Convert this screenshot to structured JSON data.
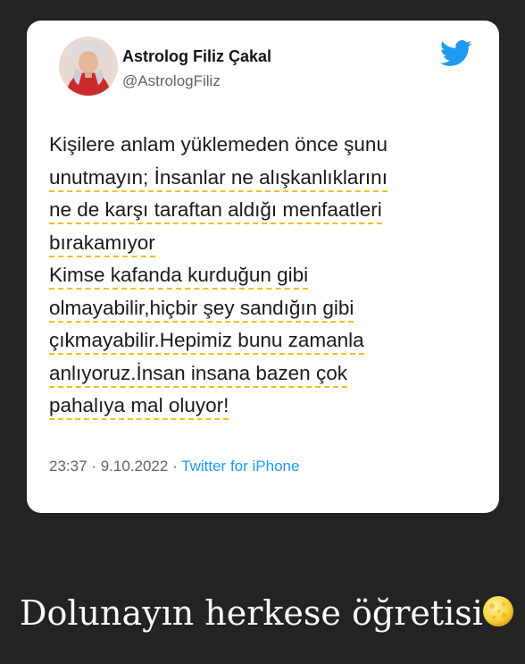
{
  "tweet": {
    "author_name": "Astrolog Filiz Çakal",
    "author_handle": "@AstrologFiliz",
    "lines": [
      "Kişilere anlam yüklemeden önce şunu",
      "unutmayın; İnsanlar ne alışkanlıklarını",
      "ne de karşı taraftan aldığı menfaatleri",
      "bırakamıyor",
      "Kimse kafanda kurduğun gibi",
      "olmayabilir,hiçbir şey sandığın gibi",
      "çıkmayabilir.Hepimiz bunu zamanla",
      "anlıyoruz.İnsan insana bazen çok",
      "pahalıya mal oluyor!"
    ],
    "time": "23:37",
    "separator": "·",
    "date": "9.10.2022",
    "source": "Twitter for iPhone"
  },
  "caption": {
    "text": "Dolunayın herkese öğretisi"
  },
  "icons": {
    "logo": "twitter-bird-icon",
    "emoji": "full-moon-face-emoji"
  },
  "colors": {
    "background": "#232323",
    "card": "#ffffff",
    "twitter_blue": "#1d9bf0",
    "highlight_underline": "#f2bf1e",
    "muted_text": "#5b6670"
  }
}
